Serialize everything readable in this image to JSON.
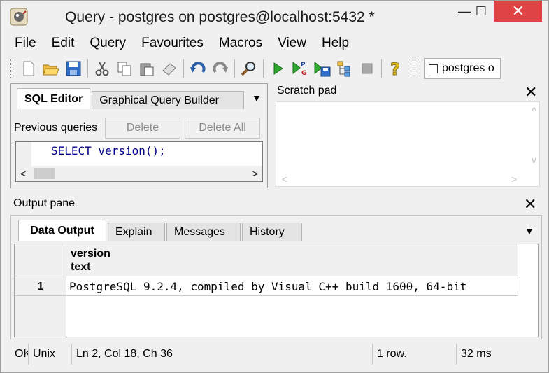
{
  "window": {
    "title": "Query - postgres on postgres@localhost:5432 *",
    "minimize_glyph": "—",
    "maximize_glyph": "☐",
    "close_glyph": "✕"
  },
  "menu": [
    "File",
    "Edit",
    "Query",
    "Favourites",
    "Macros",
    "View",
    "Help"
  ],
  "toolbar": {
    "icons": [
      "new-icon",
      "open-icon",
      "save-icon",
      "cut-icon",
      "copy-icon",
      "paste-icon",
      "clear-icon",
      "undo-icon",
      "redo-icon",
      "find-icon",
      "execute-icon",
      "execute-pgscript-icon",
      "execute-to-file-icon",
      "explain-icon",
      "cancel-icon",
      "help-icon"
    ],
    "connection_label": "postgres o"
  },
  "sql_editor": {
    "tabs": [
      "SQL Editor",
      "Graphical Query Builder"
    ],
    "previous_queries_label": "Previous queries",
    "delete_label": "Delete",
    "delete_all_label": "Delete All",
    "query_text": "SELECT version();"
  },
  "scratch_pad": {
    "title": "Scratch pad"
  },
  "output": {
    "title": "Output pane",
    "tabs": [
      "Data Output",
      "Explain",
      "Messages",
      "History"
    ],
    "columns": [
      {
        "name": "version",
        "type": "text"
      }
    ],
    "rows": [
      {
        "num": "1",
        "values": [
          "PostgreSQL 9.2.4, compiled by Visual C++ build 1600, 64-bit"
        ]
      }
    ]
  },
  "status": {
    "state": "OK",
    "line_endings": "Unix",
    "position": "Ln 2, Col 18, Ch 36",
    "rows": "1 row.",
    "time": "32 ms"
  },
  "colors": {
    "close_button": "#e04343",
    "keyword": "#00008b"
  }
}
